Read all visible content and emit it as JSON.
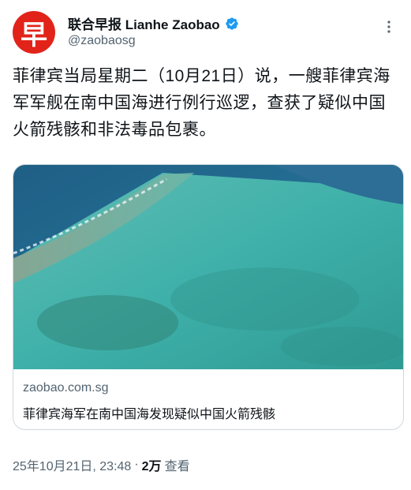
{
  "account": {
    "avatar_char": "早",
    "display_name": "联合早报 Lianhe Zaobao",
    "handle": "@zaobaosg"
  },
  "tweet": {
    "text": "菲律宾当局星期二（10月21日）说，一艘菲律宾海军军舰在南中国海进行例行巡逻，查获了疑似中国火箭残骸和非法毒品包裹。"
  },
  "card": {
    "domain": "zaobao.com.sg",
    "title": "菲律宾海军在南中国海发现疑似中国火箭残骸"
  },
  "meta": {
    "timestamp": "25年10月21日, 23:48",
    "separator": "·",
    "views_count": "2万",
    "views_label": "查看"
  },
  "colors": {
    "brand_red": "#e2231a",
    "verified_blue": "#1d9bf0",
    "secondary_text": "#536471"
  }
}
